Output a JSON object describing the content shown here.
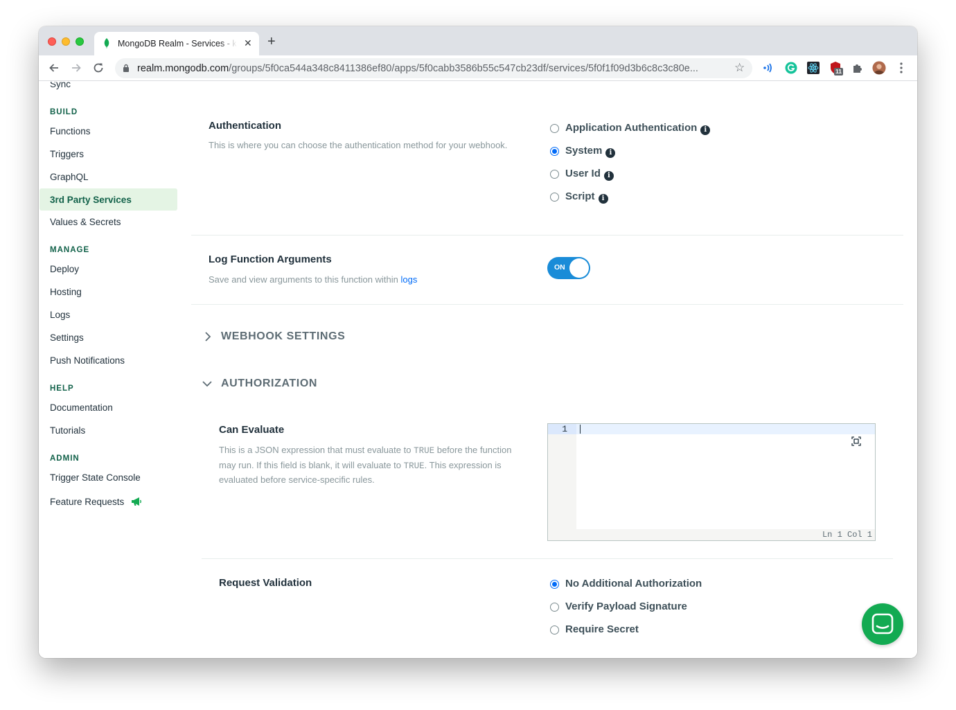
{
  "browser": {
    "tab_title": "MongoDB Realm - Services - k",
    "tab_close": "✕",
    "new_tab": "+",
    "url_host": "realm.mongodb.com",
    "url_path": "/groups/5f0ca544a348c8411386ef80/apps/5f0cabb3586b55c547cb23df/services/5f0f1f09d3b6c8c3c80e...",
    "extension_badge": "11",
    "nav_icons": [
      "back-arrow-icon",
      "forward-arrow-icon",
      "reload-icon"
    ],
    "colors": {
      "tabstrip": "#dee1e6",
      "omnibox": "#f1f3f4"
    }
  },
  "sidebar": {
    "sync": "Sync",
    "build_heading": "BUILD",
    "functions": "Functions",
    "triggers": "Triggers",
    "graphql": "GraphQL",
    "third_party_services": "3rd Party Services",
    "values_secrets": "Values & Secrets",
    "manage_heading": "MANAGE",
    "deploy": "Deploy",
    "hosting": "Hosting",
    "logs": "Logs",
    "settings": "Settings",
    "push_notifications": "Push Notifications",
    "help_heading": "HELP",
    "documentation": "Documentation",
    "tutorials": "Tutorials",
    "admin_heading": "ADMIN",
    "trigger_state_console": "Trigger State Console",
    "feature_requests": "Feature Requests",
    "active_item": "3rd Party Services"
  },
  "authentication": {
    "title": "Authentication",
    "description": "This is where you can choose the authentication method for your webhook.",
    "options": [
      {
        "label": "Application Authentication",
        "checked": false
      },
      {
        "label": "System",
        "checked": true
      },
      {
        "label": "User Id",
        "checked": false
      },
      {
        "label": "Script",
        "checked": false
      }
    ],
    "info_glyph": "i"
  },
  "log_args": {
    "title": "Log Function Arguments",
    "description": "Save and view arguments to this function within",
    "link": "logs",
    "toggle_label": "ON",
    "toggle_on": true
  },
  "webhook_settings": {
    "label": "WEBHOOK SETTINGS",
    "expanded": false
  },
  "authorization": {
    "label": "AUTHORIZATION",
    "expanded": true,
    "can_evaluate": {
      "title": "Can Evaluate",
      "desc_1": "This is a JSON expression that must evaluate to",
      "desc_true_1": "TRUE",
      "desc_2": "before the function may run. If this field is blank, it will evaluate to",
      "desc_true_2": "TRUE",
      "desc_3": ". This expression is evaluated before service-specific rules.",
      "line_number": "1",
      "status": "Ln 1 Col 1"
    }
  },
  "request_validation": {
    "title": "Request Validation",
    "options": [
      {
        "label": "No Additional Authorization",
        "checked": true
      },
      {
        "label": "Verify Payload Signature",
        "checked": false
      },
      {
        "label": "Require Secret",
        "checked": false
      }
    ]
  },
  "colors": {
    "accent_green": "#13aa52",
    "heading_green": "#116149",
    "active_bg": "#e4f4e4",
    "radio_blue": "#016bf8",
    "toggle_blue": "#1a8cd8"
  }
}
